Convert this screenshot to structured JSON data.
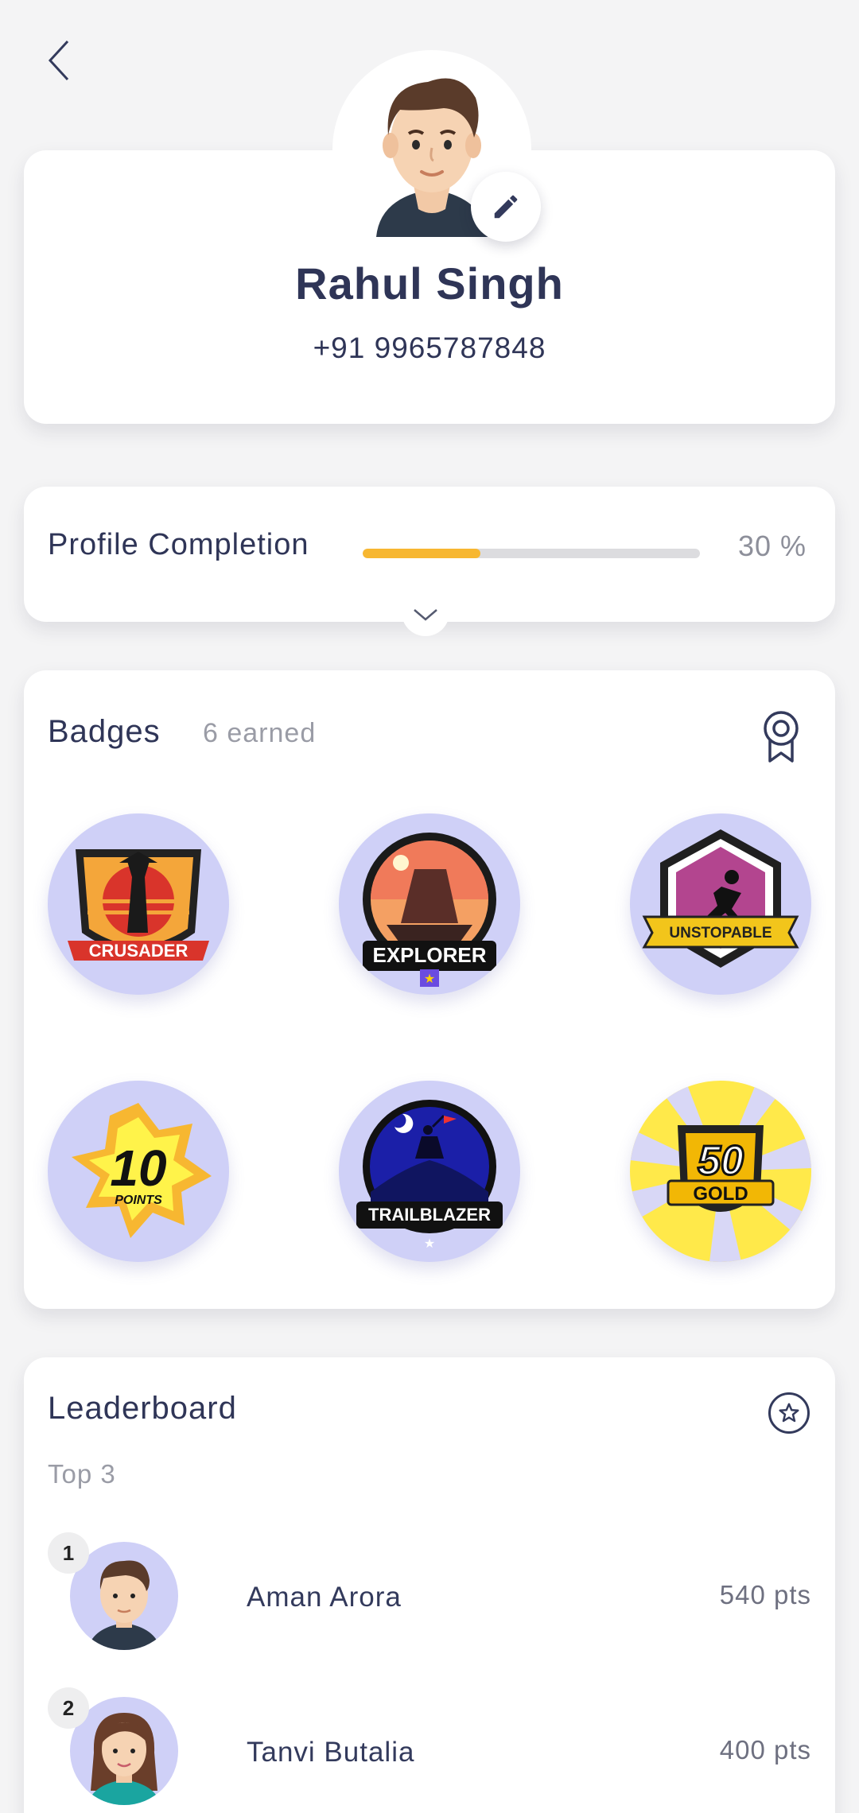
{
  "profile": {
    "name": "Rahul Singh",
    "phone": "+91 9965787848"
  },
  "completion": {
    "label": "Profile Completion",
    "percent_text": "30 %",
    "fill_fraction": 0.35
  },
  "badges": {
    "title": "Badges",
    "count_text": "6 earned",
    "items": [
      {
        "name": "CRUSADER"
      },
      {
        "name": "EXPLORER"
      },
      {
        "name": "UNSTOPABLE"
      },
      {
        "name": "10",
        "sub": "POINTS"
      },
      {
        "name": "TRAILBLAZER"
      },
      {
        "name": "50",
        "sub": "GOLD"
      }
    ]
  },
  "leaderboard": {
    "title": "Leaderboard",
    "subtitle": "Top 3",
    "entries": [
      {
        "rank": "1",
        "name": "Aman Arora",
        "points": "540 pts"
      },
      {
        "rank": "2",
        "name": "Tanvi Butalia",
        "points": "400 pts"
      }
    ]
  },
  "colors": {
    "accent": "#f7b731",
    "text": "#2f3557",
    "badge_bg": "#cfd0f7"
  },
  "icons": {
    "back": "chevron-left-icon",
    "edit": "pencil-icon",
    "expand": "chevron-down-icon",
    "badges": "award-ribbon-icon",
    "leaderboard": "star-circle-icon"
  }
}
